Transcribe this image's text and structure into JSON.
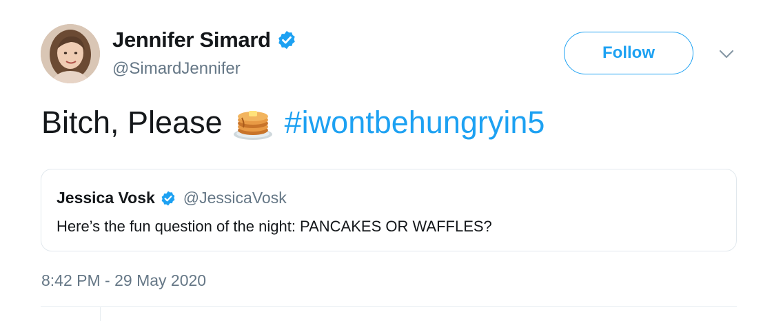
{
  "author": {
    "name": "Jennifer Simard",
    "handle": "@SimardJennifer",
    "verified": true
  },
  "follow_label": "Follow",
  "tweet": {
    "text": "Bitch, Please",
    "emoji": "pancakes-emoji",
    "hashtag": "#iwontbehungryin5"
  },
  "quoted_tweet": {
    "name": "Jessica Vosk",
    "handle": "@JessicaVosk",
    "verified": true,
    "text": "Here’s the fun question of the night: PANCAKES OR WAFFLES?"
  },
  "timestamp": "8:42 PM - 29 May 2020",
  "colors": {
    "accent": "#1da1f2",
    "text_primary": "#14171a",
    "text_secondary": "#657786",
    "border": "#e1e8ed"
  }
}
